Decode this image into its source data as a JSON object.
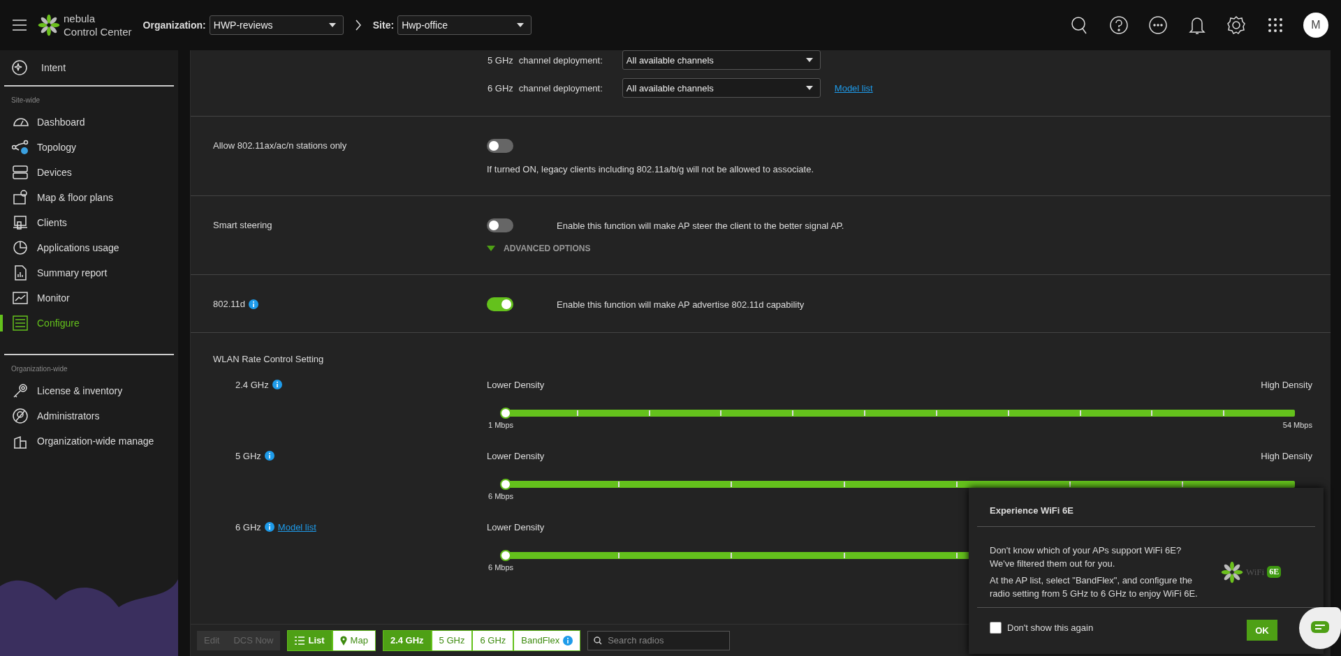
{
  "header": {
    "logo_lines": [
      "nebula",
      "Control Center"
    ],
    "org_label": "Organization:",
    "org_value": "HWP-reviews",
    "site_label": "Site:",
    "site_value": "Hwp-office",
    "avatar": "M"
  },
  "sidebar": {
    "top_item": {
      "label": "Intent"
    },
    "sections": [
      {
        "title": "Site-wide",
        "items": [
          {
            "label": "Dashboard",
            "selected": false
          },
          {
            "label": "Topology",
            "selected": false
          },
          {
            "label": "Devices",
            "selected": false
          },
          {
            "label": "Map & floor plans",
            "selected": false
          },
          {
            "label": "Clients",
            "selected": false
          },
          {
            "label": "Applications usage",
            "selected": false
          },
          {
            "label": "Summary report",
            "selected": false
          },
          {
            "label": "Monitor",
            "selected": false
          },
          {
            "label": "Configure",
            "selected": true
          }
        ]
      },
      {
        "title": "Organization-wide",
        "items": [
          {
            "label": "License & inventory",
            "selected": false
          },
          {
            "label": "Administrators",
            "selected": false
          },
          {
            "label": "Organization-wide manage",
            "selected": false
          }
        ]
      }
    ]
  },
  "channel_rows": [
    {
      "band": "5 GHz",
      "label": "channel deployment:",
      "value": "All available channels"
    },
    {
      "band": "6 GHz",
      "label": "channel deployment:",
      "value": "All available channels",
      "link": "Model list"
    }
  ],
  "settings": [
    {
      "kind": "below",
      "label": "Allow 802.11ax/ac/n stations only",
      "info": false,
      "on": false,
      "description": "If turned ON, legacy clients including 802.11a/b/g will not be allowed to associate."
    },
    {
      "kind": "beside",
      "label": "Smart steering",
      "info": false,
      "on": false,
      "description": "Enable this function will make AP steer the client to the better signal AP.",
      "advanced": "ADVANCED OPTIONS"
    },
    {
      "kind": "beside",
      "label": "802.11d",
      "info": true,
      "on": true,
      "description": "Enable this function will make AP advertise 802.11d capability"
    }
  ],
  "rate_control": {
    "title": "WLAN Rate Control Setting",
    "rows": [
      {
        "kind": "legacy",
        "band": "2.4 GHz",
        "left_label": "Lower Density",
        "right_label": "High Density",
        "min": "1  Mbps",
        "max": "54  Mbps",
        "level": 0
      },
      {
        "kind": "ofdm",
        "band": "5 GHz",
        "left_label": "Lower Density",
        "right_label": "High Density",
        "min": "6  Mbps",
        "level": 0
      },
      {
        "kind": "ofdm",
        "band": "6 GHz",
        "link": "Model list",
        "left_label": "Lower Density",
        "min": "6  Mbps",
        "level": 0
      }
    ]
  },
  "toolbar": {
    "actions": [
      {
        "label": "Edit",
        "disabled": true
      },
      {
        "label": "DCS Now",
        "disabled": true
      }
    ],
    "views": [
      {
        "label": "List",
        "selected": true
      },
      {
        "label": "Map",
        "selected": false
      }
    ],
    "bands": [
      {
        "label": "2.4 GHz",
        "selected": true
      },
      {
        "label": "5 GHz",
        "selected": false
      },
      {
        "label": "6 GHz",
        "selected": false
      },
      {
        "label": "BandFlex",
        "selected": false,
        "info": true
      }
    ],
    "search_placeholder": "Search radios"
  },
  "popup": {
    "title": "Experience WiFi 6E",
    "paragraphs": [
      "Don't know which of your APs support WiFi 6E? We've filtered them out for you.",
      "At the AP list, select \"BandFlex\", and configure the radio setting from 5 GHz to 6 GHz to enjoy WiFi 6E."
    ],
    "badge_word": "WiFi",
    "badge_mark": "6E",
    "checkbox": {
      "label": "Don't show this again",
      "checked": false
    },
    "button": "OK"
  }
}
